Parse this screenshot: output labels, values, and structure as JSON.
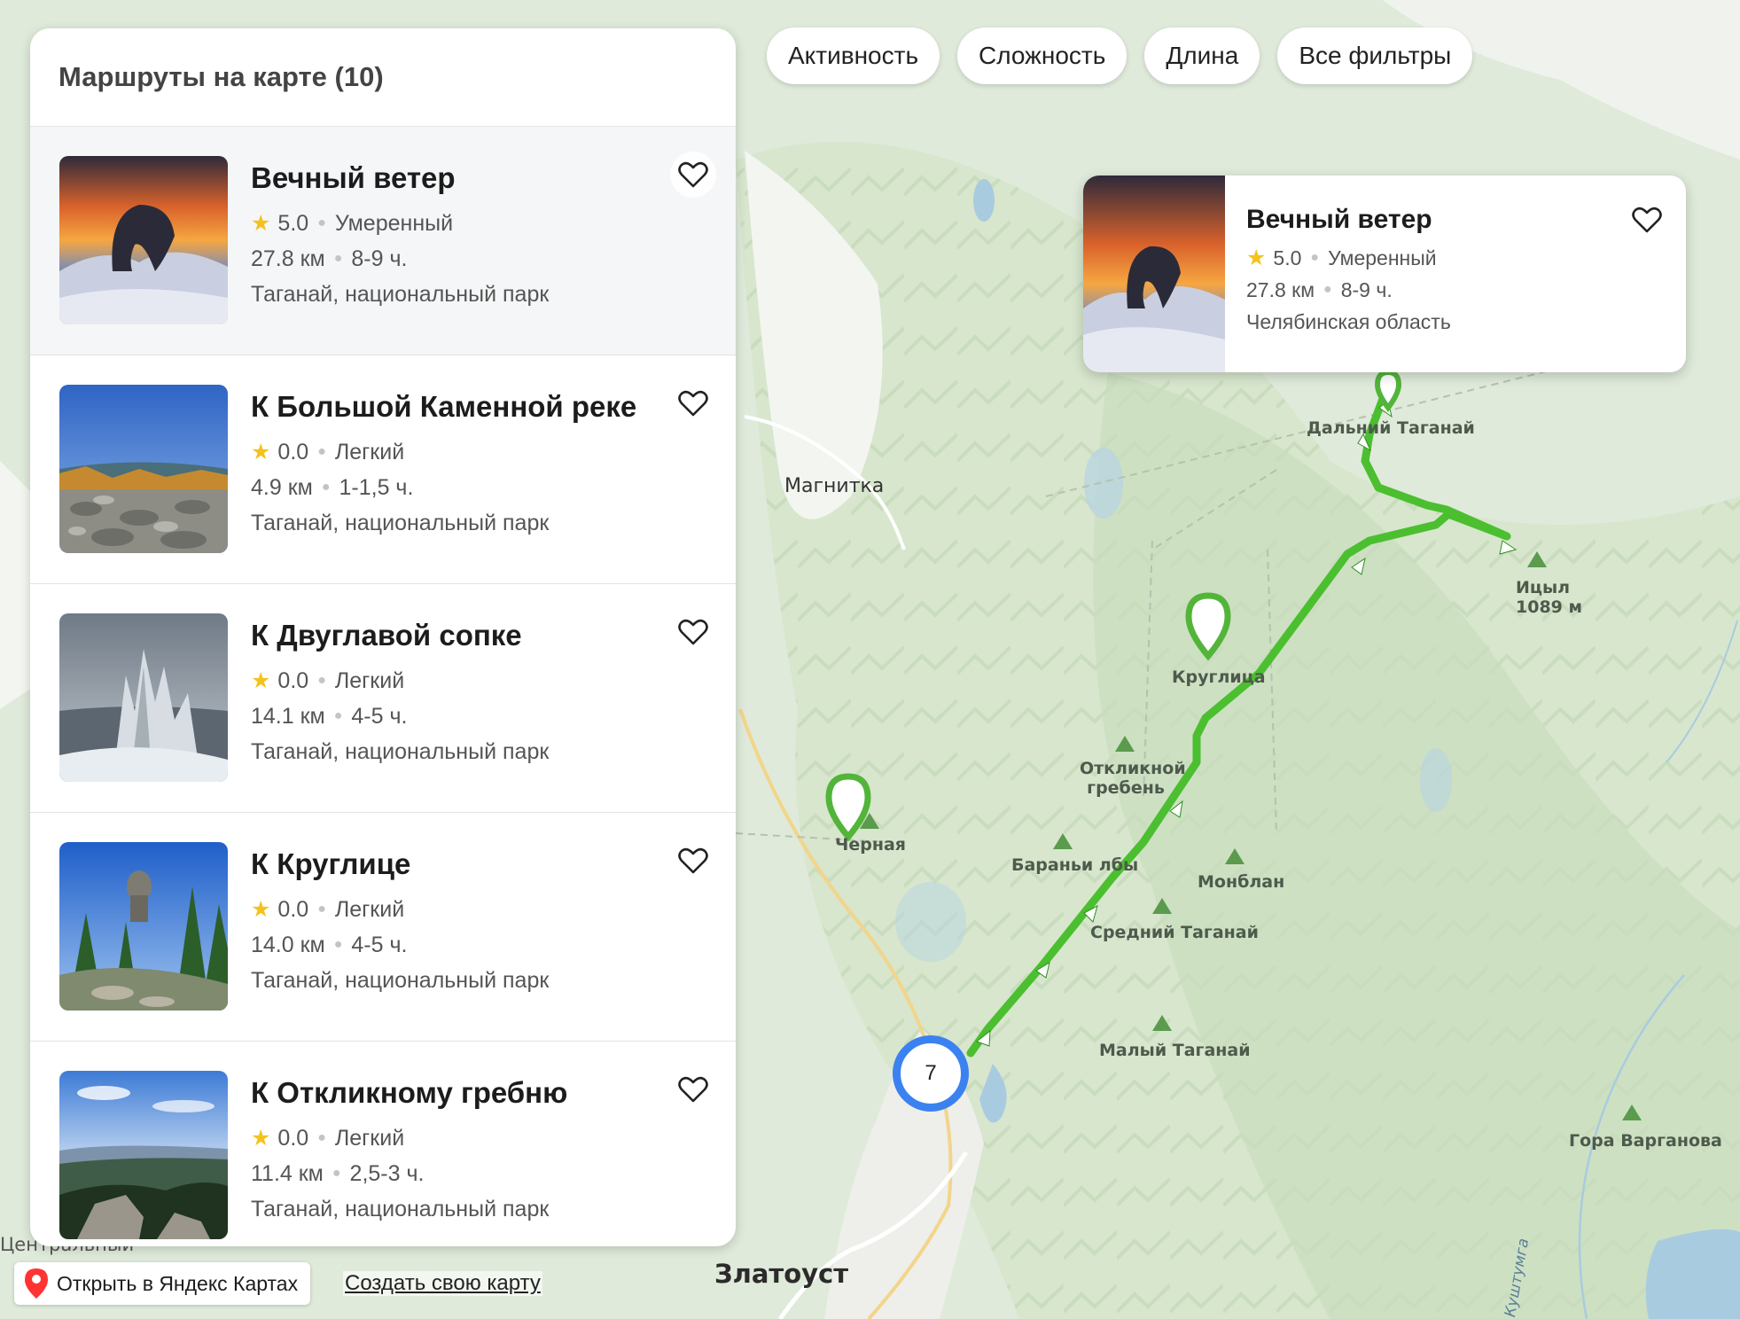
{
  "filters": [
    "Активность",
    "Сложность",
    "Длина",
    "Все фильтры"
  ],
  "panel": {
    "title": "Маршруты на карте (10)",
    "routes": [
      {
        "title": "Вечный ветер",
        "rating": "5.0",
        "difficulty": "Умеренный",
        "distance": "27.8 км",
        "duration": "8-9 ч.",
        "location": "Таганай, национальный парк",
        "thumb": "sunset-rock"
      },
      {
        "title": "К Большой Каменной реке",
        "rating": "0.0",
        "difficulty": "Легкий",
        "distance": "4.9 км",
        "duration": "1-1,5 ч.",
        "location": "Таганай, национальный парк",
        "thumb": "stone-river"
      },
      {
        "title": "К Двуглавой сопке",
        "rating": "0.0",
        "difficulty": "Легкий",
        "distance": "14.1 км",
        "duration": "4-5 ч.",
        "location": "Таганай, национальный парк",
        "thumb": "frost-rock"
      },
      {
        "title": "К Круглице",
        "rating": "0.0",
        "difficulty": "Легкий",
        "distance": "14.0 км",
        "duration": "4-5 ч.",
        "location": "Таганай, национальный парк",
        "thumb": "forest-rock"
      },
      {
        "title": "К Откликному гребню",
        "rating": "0.0",
        "difficulty": "Легкий",
        "distance": "11.4 км",
        "duration": "2,5-3 ч.",
        "location": "Таганай, национальный парк",
        "thumb": "mountain-view"
      }
    ]
  },
  "popup": {
    "title": "Вечный ветер",
    "rating": "5.0",
    "difficulty": "Умеренный",
    "distance": "27.8 км",
    "duration": "8-9 ч.",
    "location": "Челябинская область"
  },
  "map": {
    "labels": {
      "magnitka": "Магнитка",
      "dalniy": "Дальний Таганай",
      "itsyl": "Ицыл",
      "itsyl_height": "1089 м",
      "kruglitsa": "Круглица",
      "otklik_1": "Откликной",
      "otklik_2": "гребень",
      "chernaya": "Черная",
      "barani": "Бараньи лбы",
      "monblan": "Монблан",
      "sredniy": "Средний Таганай",
      "maliy": "Малый Таганай",
      "varganova": "Гора Варганова",
      "zlatoust": "Златоуст",
      "central": "Центральный",
      "kushtumga": "Куштумга"
    },
    "cluster_count": "7",
    "colors": {
      "route": "#4bbf2f",
      "pin": "#53b43a",
      "cluster": "#3b82f0",
      "water": "#a9cbe0",
      "forest": "#cfe3c4"
    }
  },
  "footer": {
    "open_label": "Открыть в Яндекс Картах",
    "create_label": "Создать свою карту"
  }
}
